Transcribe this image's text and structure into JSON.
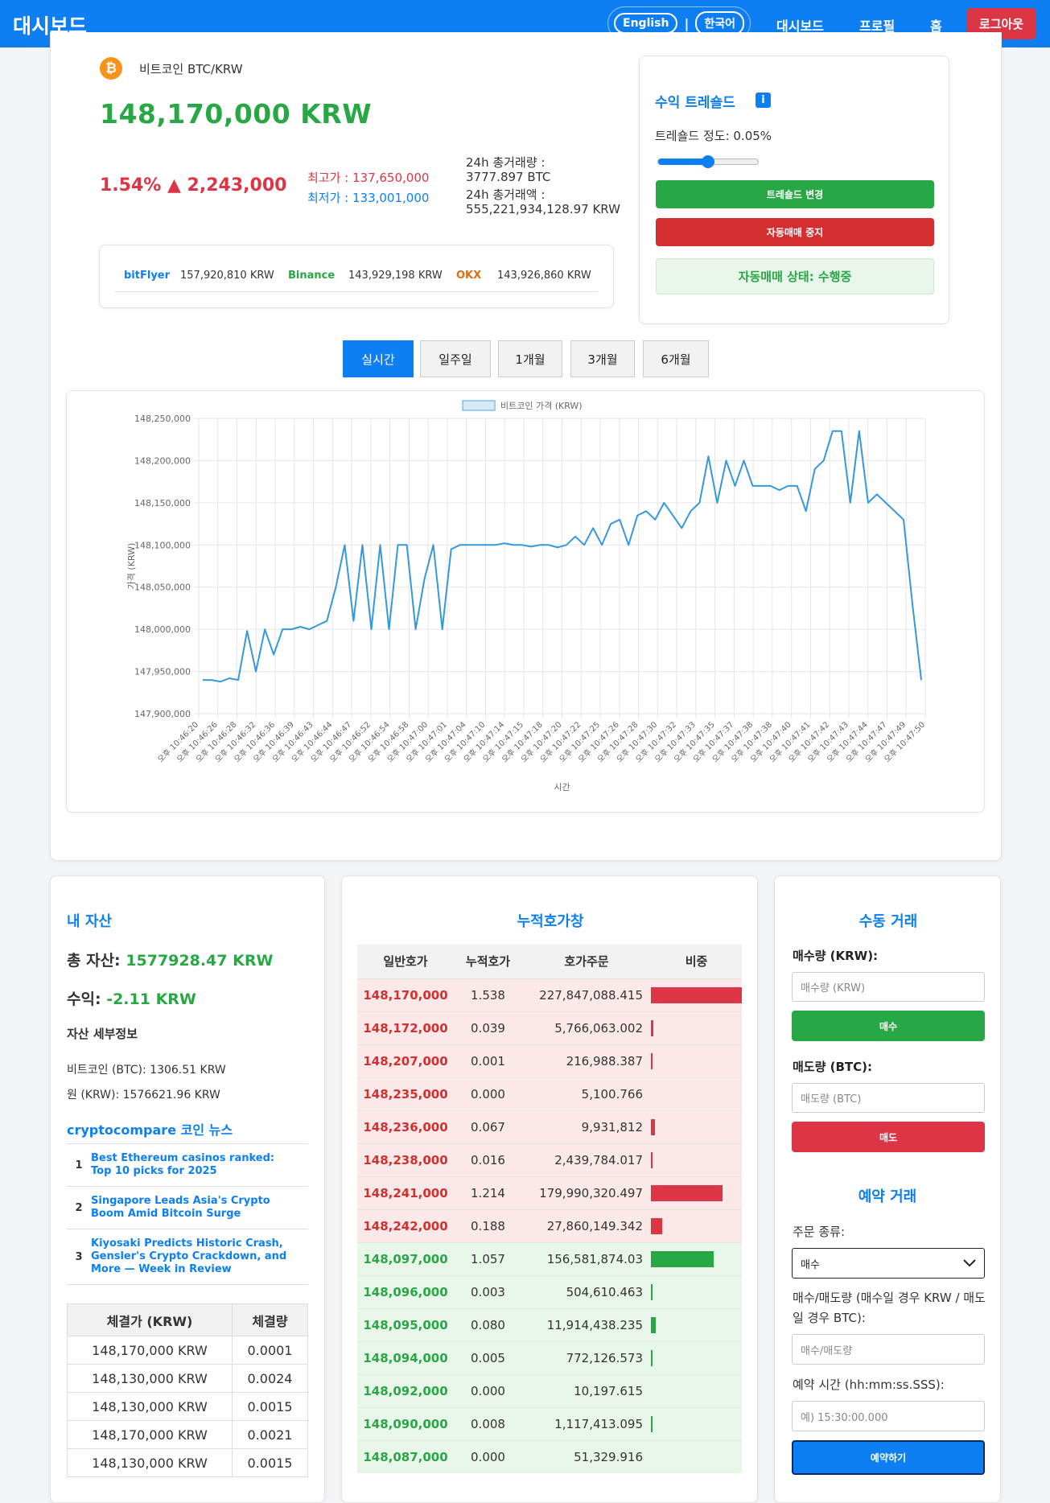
{
  "header": {
    "brand": "대시보드",
    "lang_en": "English",
    "lang_sep": "|",
    "lang_ko": "한국어",
    "nav_dashboard": "대시보드",
    "nav_profile": "프로필",
    "nav_home": "홈",
    "logout": "로그아웃"
  },
  "ticker": {
    "pair": "비트코인 BTC/KRW",
    "price": "148,170,000 KRW",
    "change": "1.54% ▲ 2,243,000",
    "high": "최고가 : 137,650,000",
    "low": "최저가 : 133,001,000",
    "vol_label": "24h 총거래량 :",
    "vol_value": "3777.897 BTC",
    "amt_label": "24h 총거래액 :",
    "amt_value": "555,221,934,128.97 KRW"
  },
  "exchanges": [
    {
      "name": "bitFlyer",
      "price": "157,920,810 KRW",
      "color": "#0d7ff3"
    },
    {
      "name": "Binance",
      "price": "143,929,198 KRW",
      "color": "#28a745"
    },
    {
      "name": "OKX",
      "price": "143,926,860 KRW",
      "color": "#e06b10"
    }
  ],
  "threshold": {
    "title": "수익 트레숄드",
    "degree": "트레숄드 정도: 0.05%",
    "slider_level": 0.5,
    "change_btn": "트레숄드 변경",
    "stop_btn": "자동매매 중지",
    "status": "자동매매 상태: 수행중"
  },
  "tabs": [
    "실시간",
    "일주일",
    "1개월",
    "3개월",
    "6개월"
  ],
  "chart_data": {
    "type": "line",
    "legend": "비트코인 가격 (KRW)",
    "ylabel": "가격 (KRW)",
    "xlabel": "시간",
    "ylim": [
      147900000,
      148250000
    ],
    "yticks": [
      "148,250,000",
      "148,200,000",
      "148,150,000",
      "148,100,000",
      "148,050,000",
      "148,000,000",
      "147,950,000",
      "147,900,000"
    ],
    "xticks": [
      "오후 10:46:20",
      "오후 10:46:26",
      "오후 10:46:28",
      "오후 10:46:32",
      "오후 10:46:36",
      "오후 10:46:39",
      "오후 10:46:43",
      "오후 10:46:44",
      "오후 10:46:47",
      "오후 10:46:52",
      "오후 10:46:54",
      "오후 10:46:58",
      "오후 10:47:00",
      "오후 10:47:01",
      "오후 10:47:04",
      "오후 10:47:10",
      "오후 10:47:14",
      "오후 10:47:15",
      "오후 10:47:18",
      "오후 10:47:20",
      "오후 10:47:22",
      "오후 10:47:25",
      "오후 10:47:26",
      "오후 10:47:28",
      "오후 10:47:30",
      "오후 10:47:32",
      "오후 10:47:33",
      "오후 10:47:35",
      "오후 10:47:37",
      "오후 10:47:38",
      "오후 10:47:38",
      "오후 10:47:40",
      "오후 10:47:41",
      "오후 10:47:42",
      "오후 10:47:43",
      "오후 10:47:44",
      "오후 10:47:47",
      "오후 10:47:49",
      "오후 10:47:50"
    ],
    "values": [
      147940000,
      147940000,
      147938000,
      147942000,
      147940000,
      147998000,
      147950000,
      148000000,
      147970000,
      148000000,
      148000000,
      148003000,
      148000000,
      148005000,
      148010000,
      148050000,
      148100000,
      148010000,
      148100000,
      148000000,
      148100000,
      148000000,
      148100000,
      148100000,
      148000000,
      148060000,
      148100000,
      148000000,
      148095000,
      148100000,
      148100000,
      148100000,
      148100000,
      148100000,
      148102000,
      148100000,
      148100000,
      148098000,
      148100000,
      148100000,
      148097000,
      148100000,
      148110000,
      148100000,
      148120000,
      148100000,
      148125000,
      148130000,
      148100000,
      148135000,
      148140000,
      148130000,
      148150000,
      148135000,
      148120000,
      148140000,
      148150000,
      148205000,
      148150000,
      148200000,
      148170000,
      148200000,
      148170000,
      148170000,
      148170000,
      148165000,
      148170000,
      148170000,
      148140000,
      148190000,
      148200000,
      148235000,
      148235000,
      148150000,
      148235000,
      148150000,
      148160000,
      148150000,
      148140000,
      148130000,
      148030000,
      147940000
    ]
  },
  "assets": {
    "title": "내 자산",
    "total_label": "총 자산:",
    "total_value": "1577928.47 KRW",
    "profit_label": "수익:",
    "profit_value": "-2.11 KRW",
    "detail_title": "자산 세부정보",
    "btc": "비트코인 (BTC): 1306.51 KRW",
    "krw": "원 (KRW): 1576621.96 KRW",
    "news_title": "cryptocompare 코인 뉴스",
    "news": [
      {
        "n": "1",
        "t": "Best Ethereum casinos ranked: Top 10 picks for 2025"
      },
      {
        "n": "2",
        "t": "Singapore Leads Asia's Crypto Boom Amid Bitcoin Surge"
      },
      {
        "n": "3",
        "t": "Kiyosaki Predicts Historic Crash, Gensler's Crypto Crackdown, and More — Week in Review"
      }
    ],
    "trades_head": [
      "체결가 (KRW)",
      "체결량"
    ],
    "trades": [
      [
        "148,170,000 KRW",
        "0.0001"
      ],
      [
        "148,130,000 KRW",
        "0.0024"
      ],
      [
        "148,130,000 KRW",
        "0.0015"
      ],
      [
        "148,170,000 KRW",
        "0.0021"
      ],
      [
        "148,130,000 KRW",
        "0.0015"
      ]
    ]
  },
  "orderbook": {
    "title": "누적호가창",
    "head": [
      "일반호가",
      "누적호가",
      "호가주문",
      "비중"
    ],
    "asks": [
      {
        "p": "148,170,000",
        "c": "1.538",
        "o": "227,847,088.415",
        "w": 100
      },
      {
        "p": "148,172,000",
        "c": "0.039",
        "o": "5,766,063.002",
        "w": 3
      },
      {
        "p": "148,207,000",
        "c": "0.001",
        "o": "216,988.387",
        "w": 1
      },
      {
        "p": "148,235,000",
        "c": "0.000",
        "o": "5,100.766",
        "w": 0
      },
      {
        "p": "148,236,000",
        "c": "0.067",
        "o": "9,931,812",
        "w": 4
      },
      {
        "p": "148,238,000",
        "c": "0.016",
        "o": "2,439,784.017",
        "w": 1
      },
      {
        "p": "148,241,000",
        "c": "1.214",
        "o": "179,990,320.497",
        "w": 79
      },
      {
        "p": "148,242,000",
        "c": "0.188",
        "o": "27,860,149.342",
        "w": 12
      }
    ],
    "bids": [
      {
        "p": "148,097,000",
        "c": "1.057",
        "o": "156,581,874.03",
        "w": 69
      },
      {
        "p": "148,096,000",
        "c": "0.003",
        "o": "504,610.463",
        "w": 1
      },
      {
        "p": "148,095,000",
        "c": "0.080",
        "o": "11,914,438.235",
        "w": 5
      },
      {
        "p": "148,094,000",
        "c": "0.005",
        "o": "772,126.573",
        "w": 1
      },
      {
        "p": "148,092,000",
        "c": "0.000",
        "o": "10,197.615",
        "w": 0
      },
      {
        "p": "148,090,000",
        "c": "0.008",
        "o": "1,117,413.095",
        "w": 1
      },
      {
        "p": "148,087,000",
        "c": "0.000",
        "o": "51,329.916",
        "w": 0
      }
    ]
  },
  "manual": {
    "title": "수동 거래",
    "buy_label": "매수량 (KRW):",
    "buy_ph": "매수량 (KRW)",
    "buy_btn": "매수",
    "sell_label": "매도량 (BTC):",
    "sell_ph": "매도량 (BTC)",
    "sell_btn": "매도"
  },
  "reserve": {
    "title": "예약 거래",
    "type_label": "주문 종류:",
    "type_value": "매수",
    "qty_label": "매수/매도량 (매수일 경우 KRW / 매도일 경우 BTC):",
    "qty_ph": "매수/매도량",
    "time_label": "예약 시간 (hh:mm:ss.SSS):",
    "time_ph": "예) 15:30:00.000",
    "btn": "예약하기"
  }
}
